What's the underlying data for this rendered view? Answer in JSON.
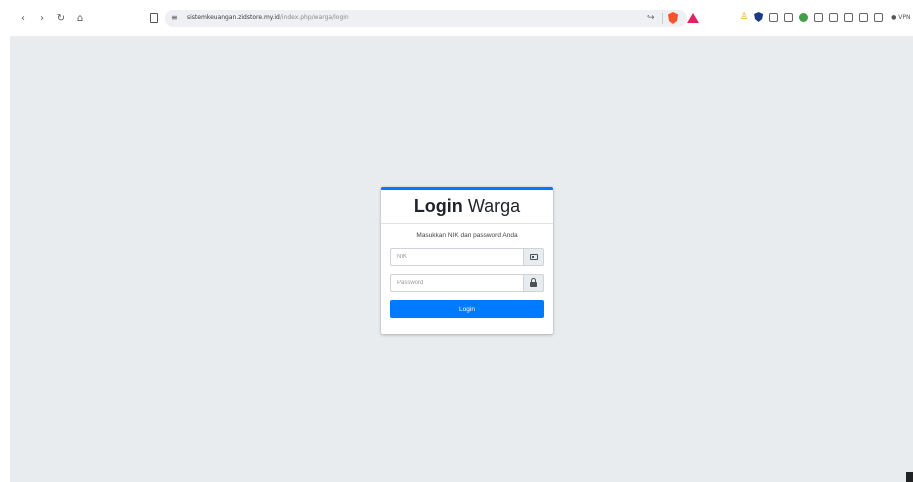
{
  "browser": {
    "url_host": "sistemkeuangan.zidstore.my.id",
    "url_path": "/index.php/warga/login",
    "vpn_label": "VPN",
    "nav_icons": [
      "back-icon",
      "forward-icon",
      "reload-icon",
      "home-icon"
    ],
    "accent_brave": "#fb542b",
    "accent_rewards": "#e0245e"
  },
  "login": {
    "title_bold": "Login",
    "title_light": "Warga",
    "message": "Masukkan NIK dan password Anda",
    "nik_placeholder": "NIK",
    "password_placeholder": "Password",
    "button_label": "Login",
    "accent_color": "#007bff",
    "page_background": "#e9ecef"
  }
}
